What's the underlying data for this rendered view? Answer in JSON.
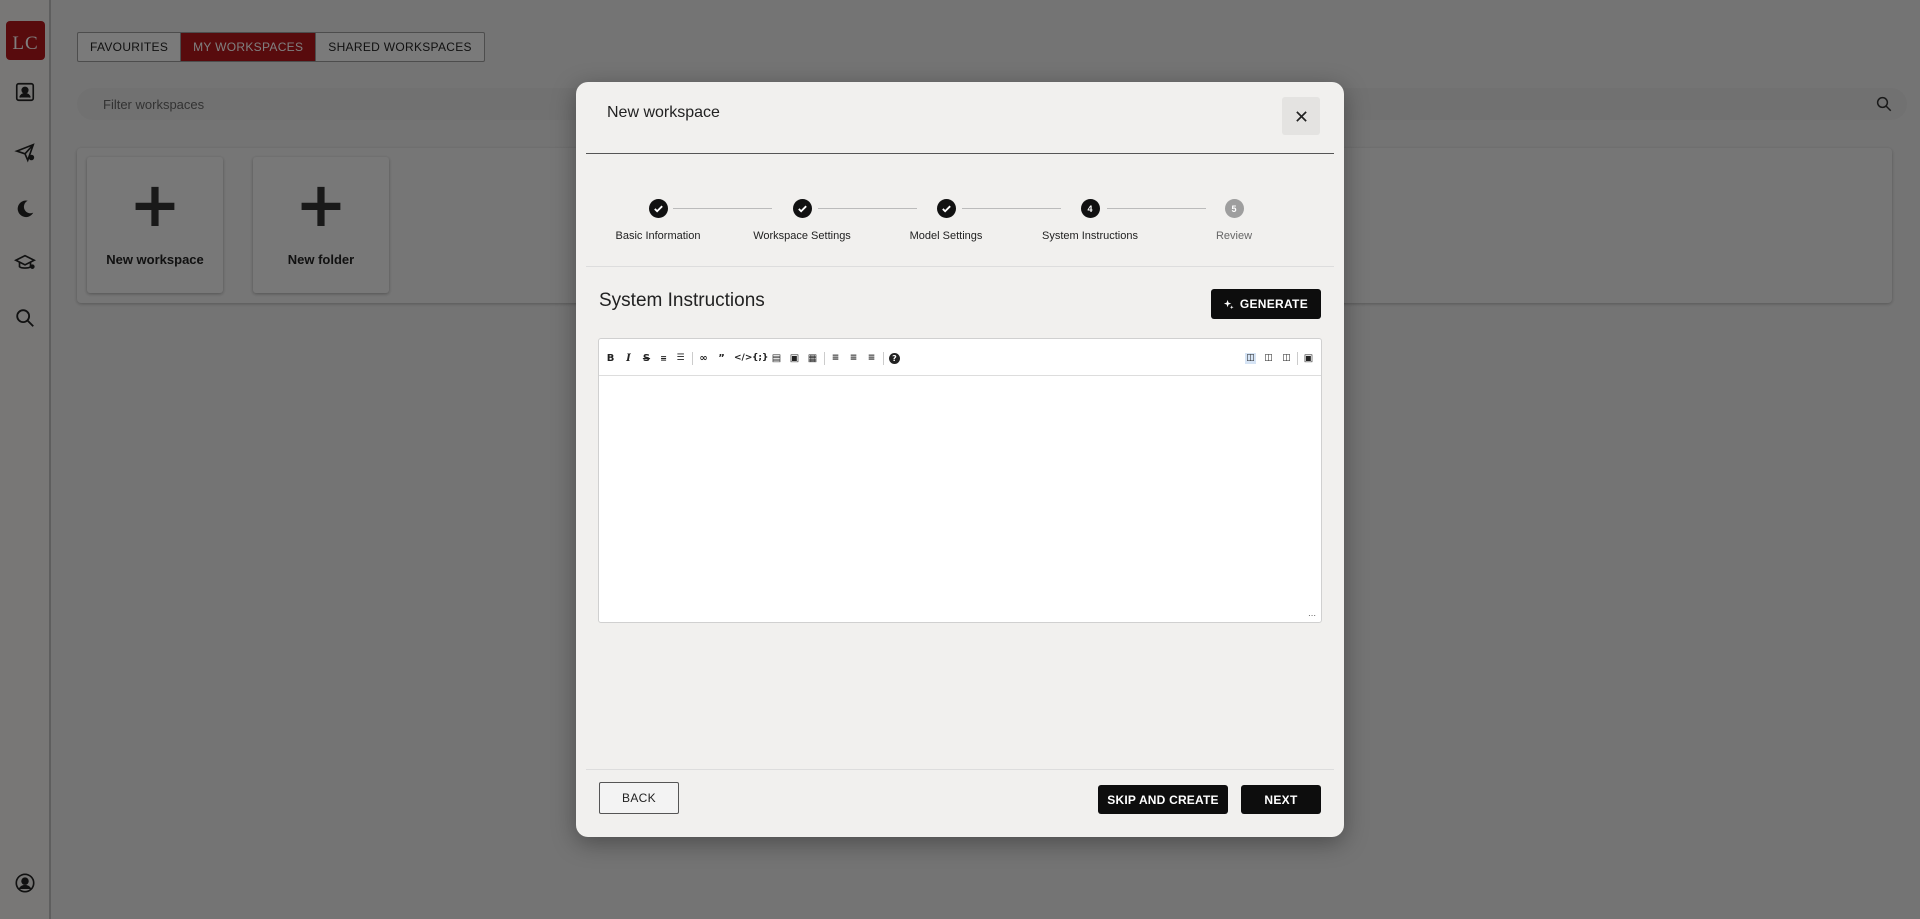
{
  "app": {
    "logo_text": "LC"
  },
  "sidebar": {
    "icons": [
      "contact-card-icon",
      "send-icon",
      "moon-icon",
      "graduation-cap-icon",
      "search-icon",
      "user-circle-icon"
    ]
  },
  "tabs": [
    {
      "label": "FAVOURITES",
      "active": false
    },
    {
      "label": "MY WORKSPACES",
      "active": true
    },
    {
      "label": "SHARED WORKSPACES",
      "active": false
    }
  ],
  "filter": {
    "placeholder": "Filter workspaces"
  },
  "cards": [
    {
      "label": "New workspace"
    },
    {
      "label": "New folder"
    }
  ],
  "modal": {
    "title": "New workspace",
    "steps": [
      {
        "label": "Basic Information",
        "status": "done"
      },
      {
        "label": "Workspace Settings",
        "status": "done"
      },
      {
        "label": "Model Settings",
        "status": "done"
      },
      {
        "label": "System Instructions",
        "status": "current",
        "number": "4"
      },
      {
        "label": "Review",
        "status": "pending",
        "number": "5"
      }
    ],
    "section_title": "System Instructions",
    "generate_label": "GENERATE",
    "editor": {
      "content": "",
      "toolbar_left": [
        "bold-icon",
        "italic-icon",
        "strikethrough-icon",
        "horizontal-rule-icon",
        "title-icon",
        "link-icon",
        "quote-icon",
        "code-icon",
        "code-block-icon",
        "comment-icon",
        "image-icon",
        "table-icon",
        "unordered-list-icon",
        "ordered-list-icon",
        "checked-list-icon",
        "help-icon"
      ],
      "toolbar_right": [
        "edit-mode-icon",
        "live-mode-icon",
        "preview-mode-icon",
        "fullscreen-icon"
      ],
      "active_mode": "edit-mode-icon"
    },
    "back_label": "BACK",
    "skip_label": "SKIP AND CREATE",
    "next_label": "NEXT"
  },
  "colors": {
    "brand": "#b0171b",
    "primary_button": "#0d0d0d"
  }
}
